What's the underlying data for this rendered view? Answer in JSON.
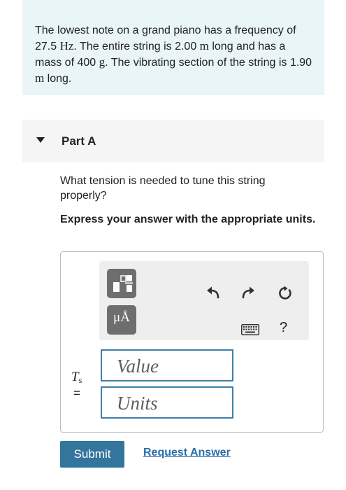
{
  "problem": {
    "segments": [
      "The lowest note on a grand piano has a frequency of 27.5 ",
      "Hz",
      ". The entire string is 2.00 ",
      "m",
      " long and has a mass of 400 ",
      "g",
      ". The vibrating section of the string is 1.90 ",
      "m",
      " long."
    ]
  },
  "part": {
    "title": "Part A"
  },
  "question": {
    "text": "What tension is needed to tune this string properly?",
    "instruction": "Express your answer with the appropriate units."
  },
  "toolbar": {
    "units_glyph": "μÅ",
    "help_label": "?",
    "icons": [
      "templates-icon",
      "units-icon",
      "undo-icon",
      "redo-icon",
      "reset-icon",
      "keyboard-icon",
      "help-icon"
    ]
  },
  "answer": {
    "variable": "T",
    "variable_subscript": "s",
    "equals": "=",
    "value_placeholder": "Value",
    "units_placeholder": "Units"
  },
  "actions": {
    "submit_label": "Submit",
    "request_answer_label": "Request Answer"
  },
  "colors": {
    "problem_bg": "#e9f5f6",
    "accent": "#33759d",
    "field_border": "#3e7ea9",
    "link": "#2a6fa8"
  }
}
